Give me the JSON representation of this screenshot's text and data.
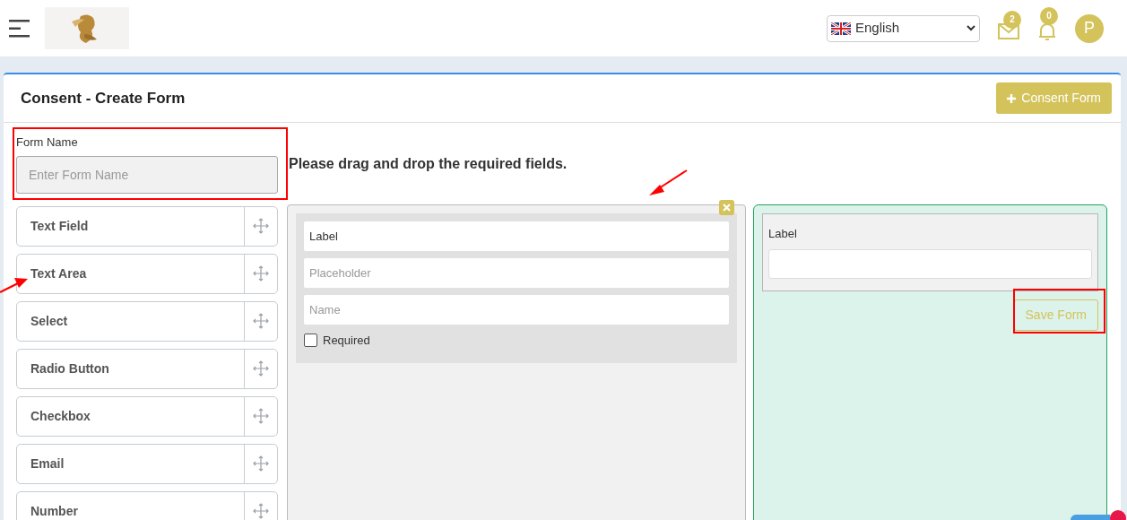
{
  "header": {
    "language": "English",
    "messages_badge": "2",
    "notifications_badge": "0",
    "avatar": "P"
  },
  "card": {
    "title": "Consent - Create Form",
    "add_button": "Consent Form"
  },
  "form_name": {
    "label": "Form Name",
    "placeholder": "Enter Form Name"
  },
  "field_types": [
    "Text Field",
    "Text Area",
    "Select",
    "Radio Button",
    "Checkbox",
    "Email",
    "Number"
  ],
  "instruction": "Please drag and drop the required fields.",
  "editor": {
    "inputs": [
      {
        "value": "Label"
      },
      {
        "placeholder": "Placeholder"
      },
      {
        "placeholder": "Name"
      }
    ],
    "required": {
      "label": "Required",
      "checked": false
    }
  },
  "preview": {
    "label": "Label",
    "save_button": "Save Form"
  }
}
